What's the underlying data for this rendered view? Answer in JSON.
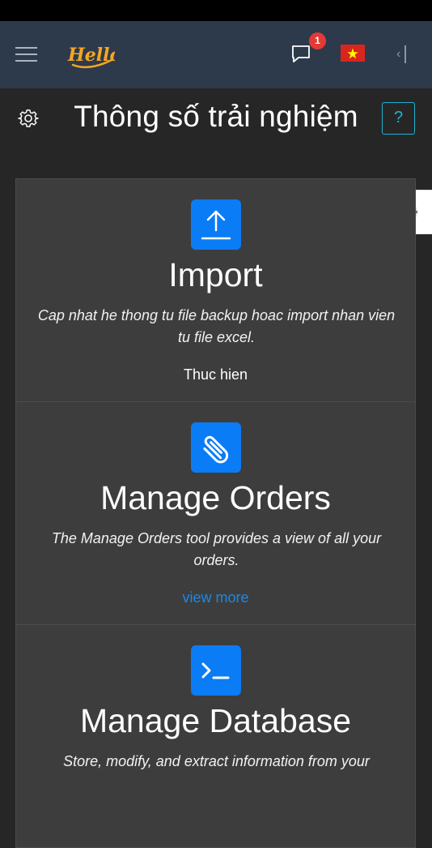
{
  "navbar": {
    "notification_count": "1",
    "colors": {
      "background": "#2d3a4b",
      "badge": "#e53935",
      "logo": "#f5a623"
    }
  },
  "page": {
    "title": "Thông số trải nghiệm",
    "help_label": "?",
    "colors": {
      "help_accent": "#1fb3d1"
    }
  },
  "cards": [
    {
      "icon": "upload-icon",
      "title": "Import",
      "description": "Cap nhat he thong tu file backup hoac import nhan vien tu file excel.",
      "link": "Thuc hien",
      "link_color": "#ffffff"
    },
    {
      "icon": "paperclip-icon",
      "title": "Manage Orders",
      "description": "The Manage Orders tool provides a view of all your orders.",
      "link": "view more",
      "link_color": "#1e88e5"
    },
    {
      "icon": "terminal-icon",
      "title": "Manage Database",
      "description": "Store, modify, and extract information from your",
      "link": "",
      "link_color": "#1e88e5"
    }
  ],
  "theme": {
    "icon_tile": "#0a7cf5",
    "card_bg": "#3d3d3d",
    "page_bg": "#262626"
  }
}
